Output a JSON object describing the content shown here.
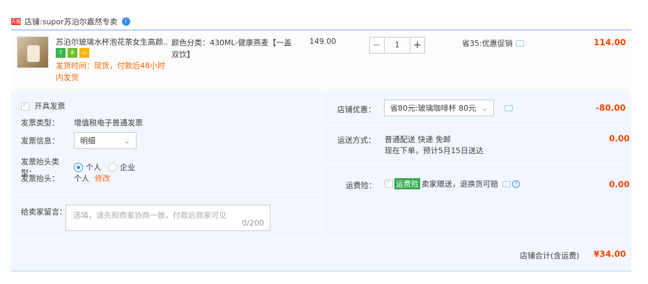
{
  "shop": {
    "badge": "天猫",
    "label": "店铺:",
    "name": "supor苏泊尔嘉然专卖",
    "ww_badge": "!"
  },
  "item": {
    "title": "苏泊尔玻璃水杯泡花茶女生高颜...",
    "badges": [
      "7",
      "⋔",
      "▭"
    ],
    "delivery": "发货时间：现货，付款后48小时内发货",
    "sku": "颜色分类：430ML-健康燕麦【一盖双饮】",
    "unit_price": "149.00",
    "qty": "1",
    "qty_minus": "−",
    "qty_plus": "+",
    "promo": "省35:优惠促销",
    "line_total": "114.00"
  },
  "invoice": {
    "open_label": "开具发票",
    "type_key": "发票类型：",
    "type_val": "增值税电子普通发票",
    "info_key": "发票信息：",
    "info_val": "明细",
    "title_type_key": "发票抬头类型：",
    "opt_personal": "个人",
    "opt_company": "企业",
    "title_key": "发票抬头：",
    "title_val": "个人",
    "edit": "修改"
  },
  "message": {
    "key": "给卖家留言：",
    "placeholder": "选填，请先和商家协商一致，付款后商家可见",
    "count": "0/200"
  },
  "coupon": {
    "key": "店铺优惠：",
    "value": "省80元:玻璃咖啡杯 80元",
    "amount": "-80.00"
  },
  "shipping": {
    "key": "运送方式：",
    "line1": "普通配送 快递 免邮",
    "line2": "现在下单，预计5月15日送达",
    "amount": "0.00"
  },
  "insurance": {
    "key": "运费险：",
    "tag": "运费险",
    "text": "卖家赠送，退换货可赔",
    "amount": "0.00"
  },
  "subtotal": {
    "label": "店铺合计(含运费)",
    "amount": "¥34.00"
  },
  "colors": {
    "accent": "#f40",
    "panel": "#f2f7ff",
    "blue_line": "#b2d1ff"
  }
}
